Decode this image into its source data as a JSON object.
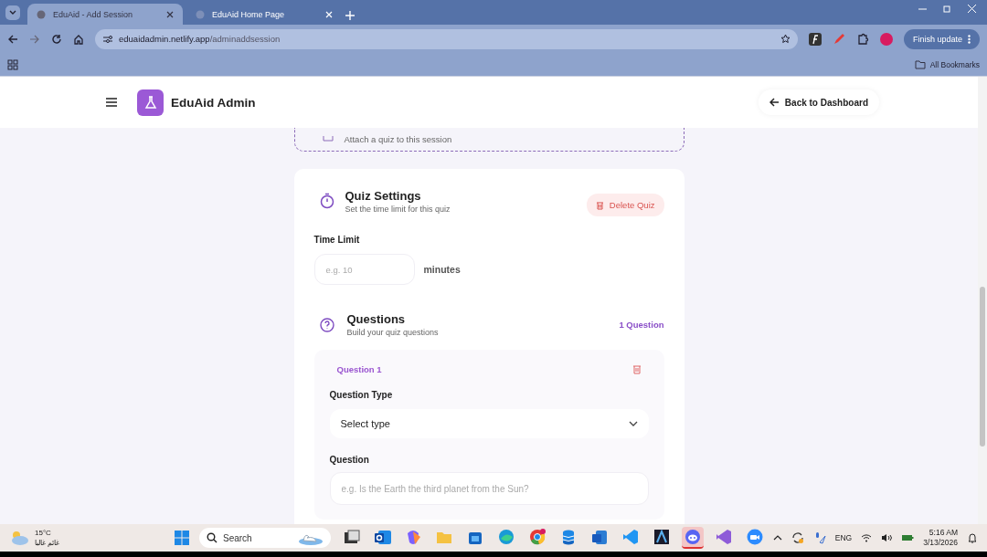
{
  "browser": {
    "tabs": [
      {
        "title": "EduAid - Add Session",
        "selected": true
      },
      {
        "title": "EduAid Home Page",
        "selected": false
      }
    ],
    "url_host": "eduaidadmin.netlify.app",
    "url_path": "/adminaddsession",
    "update_button": "Finish update",
    "bookmarks": "All Bookmarks"
  },
  "app": {
    "title": "EduAid Admin",
    "back_button": "Back to Dashboard",
    "attach_hint": "Attach a quiz to this session",
    "quiz_settings": {
      "title": "Quiz Settings",
      "subtitle": "Set the time limit for this quiz",
      "delete_button": "Delete Quiz"
    },
    "time_limit": {
      "label": "Time Limit",
      "placeholder": "e.g. 10",
      "unit": "minutes"
    },
    "questions": {
      "title": "Questions",
      "subtitle": "Build your quiz questions",
      "count": "1 Question"
    },
    "question_card": {
      "label": "Question 1",
      "type_label": "Question Type",
      "type_value": "Select type",
      "question_label": "Question",
      "question_placeholder": "e.g. Is the Earth the third planet from the Sun?"
    }
  },
  "taskbar": {
    "temperature": "15°C",
    "weather": "غائم غالبا",
    "search": "Search",
    "apps": [
      {
        "kind": "taskview",
        "selected": false
      },
      {
        "kind": "outlook",
        "selected": false
      },
      {
        "kind": "copilot",
        "selected": false
      },
      {
        "kind": "folder",
        "selected": false
      },
      {
        "kind": "store",
        "selected": false
      },
      {
        "kind": "edge",
        "selected": false
      },
      {
        "kind": "chrome",
        "selected": false
      },
      {
        "kind": "database",
        "selected": false
      },
      {
        "kind": "word",
        "selected": false
      },
      {
        "kind": "vscode",
        "selected": false
      },
      {
        "kind": "arch",
        "selected": false
      },
      {
        "kind": "discord",
        "selected": true
      },
      {
        "kind": "studio",
        "selected": false
      },
      {
        "kind": "zoom",
        "selected": false
      }
    ],
    "language": "ENG",
    "time": "5:16 AM",
    "date": "3/13/2026"
  }
}
